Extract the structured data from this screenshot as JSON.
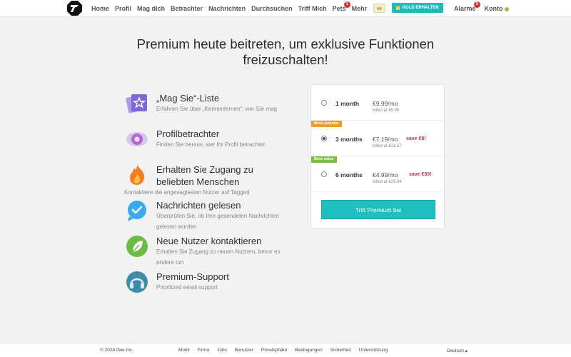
{
  "nav": {
    "items": [
      "Home",
      "Profil",
      "Mag dich",
      "Betrachter",
      "Nachrichten",
      "Durchsuchen",
      "Triff Mich",
      "Pets",
      "Mehr"
    ],
    "pets_badge": "1",
    "gold_label": "GOLD ERHALTEN",
    "alarms_label": "Alarme",
    "alarms_badge": "3",
    "account_label": "Konto"
  },
  "headline": "Premium heute beitreten, um exklusive Funktionen freizuschalten!",
  "features": [
    {
      "icon": "star-cards-icon",
      "title": "„Mag Sie“-Liste",
      "desc": "Erfahren Sie über „Kennenlernen“, wer Sie mag"
    },
    {
      "icon": "eye-icon",
      "title": "Profilbetrachter",
      "desc": "Finden Sie heraus, wer Ihr Profil betrachtet"
    },
    {
      "icon": "flame-icon",
      "title": "Erhalten Sie Zugang zu beliebten Menschen",
      "desc": "Kontaktiere die angesagtesten Nutzer auf Tagged"
    },
    {
      "icon": "checkmark-bubble-icon",
      "title": "Nachrichten gelesen",
      "desc": "Überprüfen Sie, ob Ihre gesendeten Nachrichten gelesen wurden"
    },
    {
      "icon": "leaf-icon",
      "title": "Neue Nutzer kontaktieren",
      "desc": "Erhalten Sie Zugang zu neuen Nutzern, bevor es andere tun"
    },
    {
      "icon": "headset-icon",
      "title": "Premium-Support",
      "desc": "Prioritized email support"
    }
  ],
  "plans": [
    {
      "name": "1 month",
      "price": "€9.99/mo",
      "billed": "billed at €9.99",
      "save": "",
      "ribbon": "",
      "selected": false
    },
    {
      "name": "3 months",
      "price": "€7.19/mo",
      "billed": "billed at €21.57",
      "save": "save €8!",
      "ribbon": "Most popular",
      "selected": true
    },
    {
      "name": "6 months",
      "price": "€4.99/mo",
      "billed": "billed at €29.94",
      "save": "save €30!",
      "ribbon": "Best value",
      "selected": false
    }
  ],
  "cta_label": "Tritt Premium bei",
  "footer": {
    "copyright": "© 2024 Ifwe Inc.",
    "links": [
      "Mobil",
      "Firma",
      "Jobs",
      "Benutzer",
      "Privatsphäre",
      "Bedingungen",
      "Sicherheit",
      "Unterstützung"
    ],
    "language": "Deutsch ▴"
  },
  "colors": {
    "accent": "#1fbfbf",
    "ribbon_popular": "#f29a2e",
    "ribbon_value": "#7cc043",
    "save": "#b23a48"
  }
}
